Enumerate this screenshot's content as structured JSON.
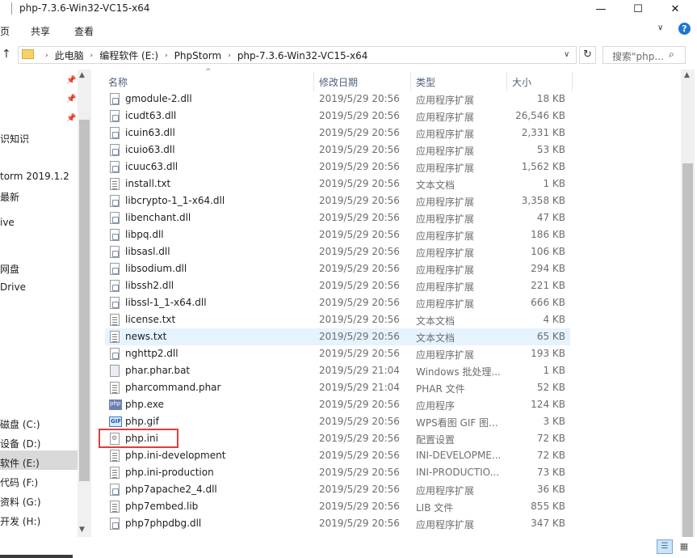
{
  "window": {
    "title": "php-7.3.6-Win32-VC15-x64",
    "minimize": "—",
    "maximize": "☐",
    "close": "✕"
  },
  "ribbon": {
    "tabs": [
      "页",
      "共享",
      "查看"
    ],
    "collapse": "∨",
    "help": "?"
  },
  "address": {
    "up": "↑",
    "breadcrumbs": [
      "此电脑",
      "编程软件 (E:)",
      "PhpStorm",
      "php-7.3.6-Win32-VC15-x64"
    ],
    "separator": "›",
    "dropdown": "∨",
    "refresh": "↻"
  },
  "search": {
    "placeholder": "搜索\"php...",
    "icon": "⌕"
  },
  "nav": {
    "items": [
      "识知识",
      "torm 2019.1.2",
      "最新",
      "ive",
      "网盘",
      "Drive",
      "磁盘 (C:)",
      "设备 (D:)",
      "软件 (E:)",
      "代码 (F:)",
      "资料 (G:)",
      "开发 (H:)"
    ],
    "selected": "软件 (E:)"
  },
  "columns": {
    "name": "名称",
    "date": "修改日期",
    "type": "类型",
    "size": "大小",
    "sort": "^"
  },
  "files": [
    {
      "name": "gmodule-2.dll",
      "date": "2019/5/29 20:56",
      "type": "应用程序扩展",
      "size": "18 KB",
      "icon": "dll"
    },
    {
      "name": "icudt63.dll",
      "date": "2019/5/29 20:56",
      "type": "应用程序扩展",
      "size": "26,546 KB",
      "icon": "dll"
    },
    {
      "name": "icuin63.dll",
      "date": "2019/5/29 20:56",
      "type": "应用程序扩展",
      "size": "2,331 KB",
      "icon": "dll"
    },
    {
      "name": "icuio63.dll",
      "date": "2019/5/29 20:56",
      "type": "应用程序扩展",
      "size": "53 KB",
      "icon": "dll"
    },
    {
      "name": "icuuc63.dll",
      "date": "2019/5/29 20:56",
      "type": "应用程序扩展",
      "size": "1,562 KB",
      "icon": "dll"
    },
    {
      "name": "install.txt",
      "date": "2019/5/29 20:56",
      "type": "文本文档",
      "size": "1 KB",
      "icon": "txt"
    },
    {
      "name": "libcrypto-1_1-x64.dll",
      "date": "2019/5/29 20:56",
      "type": "应用程序扩展",
      "size": "3,358 KB",
      "icon": "dll"
    },
    {
      "name": "libenchant.dll",
      "date": "2019/5/29 20:56",
      "type": "应用程序扩展",
      "size": "47 KB",
      "icon": "dll"
    },
    {
      "name": "libpq.dll",
      "date": "2019/5/29 20:56",
      "type": "应用程序扩展",
      "size": "186 KB",
      "icon": "dll"
    },
    {
      "name": "libsasl.dll",
      "date": "2019/5/29 20:56",
      "type": "应用程序扩展",
      "size": "106 KB",
      "icon": "dll"
    },
    {
      "name": "libsodium.dll",
      "date": "2019/5/29 20:56",
      "type": "应用程序扩展",
      "size": "294 KB",
      "icon": "dll"
    },
    {
      "name": "libssh2.dll",
      "date": "2019/5/29 20:56",
      "type": "应用程序扩展",
      "size": "221 KB",
      "icon": "dll"
    },
    {
      "name": "libssl-1_1-x64.dll",
      "date": "2019/5/29 20:56",
      "type": "应用程序扩展",
      "size": "666 KB",
      "icon": "dll"
    },
    {
      "name": "license.txt",
      "date": "2019/5/29 20:56",
      "type": "文本文档",
      "size": "4 KB",
      "icon": "txt"
    },
    {
      "name": "news.txt",
      "date": "2019/5/29 20:56",
      "type": "文本文档",
      "size": "65 KB",
      "icon": "txt",
      "highlight": true
    },
    {
      "name": "nghttp2.dll",
      "date": "2019/5/29 20:56",
      "type": "应用程序扩展",
      "size": "193 KB",
      "icon": "dll"
    },
    {
      "name": "phar.phar.bat",
      "date": "2019/5/29 21:04",
      "type": "Windows 批处理...",
      "size": "1 KB",
      "icon": "bat"
    },
    {
      "name": "pharcommand.phar",
      "date": "2019/5/29 21:04",
      "type": "PHAR 文件",
      "size": "52 KB",
      "icon": "txt"
    },
    {
      "name": "php.exe",
      "date": "2019/5/29 20:56",
      "type": "应用程序",
      "size": "124 KB",
      "icon": "exe"
    },
    {
      "name": "php.gif",
      "date": "2019/5/29 20:56",
      "type": "WPS看图 GIF 图...",
      "size": "3 KB",
      "icon": "gif"
    },
    {
      "name": "php.ini",
      "date": "2019/5/29 20:56",
      "type": "配置设置",
      "size": "72 KB",
      "icon": "ini"
    },
    {
      "name": "php.ini-development",
      "date": "2019/5/29 20:56",
      "type": "INI-DEVELOPME...",
      "size": "72 KB",
      "icon": "txt"
    },
    {
      "name": "php.ini-production",
      "date": "2019/5/29 20:56",
      "type": "INI-PRODUCTIO...",
      "size": "73 KB",
      "icon": "txt"
    },
    {
      "name": "php7apache2_4.dll",
      "date": "2019/5/29 20:56",
      "type": "应用程序扩展",
      "size": "36 KB",
      "icon": "dll"
    },
    {
      "name": "php7embed.lib",
      "date": "2019/5/29 20:56",
      "type": "LIB 文件",
      "size": "855 KB",
      "icon": "txt"
    },
    {
      "name": "php7phpdbg.dll",
      "date": "2019/5/29 20:56",
      "type": "应用程序扩展",
      "size": "347 KB",
      "icon": "dll"
    }
  ],
  "colors": {
    "highlight_row": "#e5f3ff",
    "annotation_box": "#e03c3c",
    "header_text": "#4c607a"
  },
  "status": {
    "view_details": "☰",
    "view_tiles": "▦"
  }
}
